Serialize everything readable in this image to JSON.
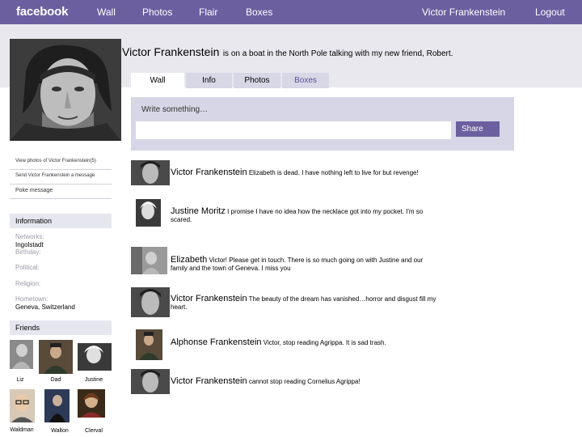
{
  "nav": {
    "logo": "facebook",
    "wall": "Wall",
    "photos": "Photos",
    "flair": "Flair",
    "boxes": "Boxes",
    "user": "Victor Frankenstein",
    "logout": "Logout"
  },
  "profile": {
    "name": "Victor Frankenstein",
    "status": "is on a boat in the North Pole talking with my new friend, Robert."
  },
  "tabs": [
    "Wall",
    "Info",
    "Photos",
    "Boxes"
  ],
  "composer": {
    "label": "Write something…",
    "value": "",
    "share": "Share"
  },
  "sidebar": {
    "links": [
      "View photos of Victor Frankenstein(5)",
      "Send Victor Frankenstein a message",
      "Poke message"
    ],
    "information_title": "Information",
    "info": {
      "networks_label": "Networks:",
      "networks_value": "Ingolstadt",
      "birthday_label": "Birthday:",
      "political_label": "Political:",
      "religion_label": "Religion:",
      "hometown_label": "Hometown:",
      "hometown_value": "Geneva, Switzerland"
    },
    "friends_title": "Friends",
    "friends": [
      "Liz",
      "Dad",
      "Justine",
      "Waldman",
      "Walton",
      "Clerval"
    ]
  },
  "posts": [
    {
      "author": "Victor Frankenstein",
      "text": "Elizabeth is dead.  I have nothing left to live for but revenge!"
    },
    {
      "author": "Justine Moritz",
      "text": "I promise I have no idea how the necklace got into my pocket.  I'm so scared."
    },
    {
      "author": "Elizabeth",
      "text": "Victor!  Please get in touch.  There is so much going on with Justine and our family and the town of Geneva.  I miss you"
    },
    {
      "author": "Victor Frankenstein",
      "text": "The beauty of the dream has vanished…horror and disgust fill my heart."
    },
    {
      "author": "Alphonse Frankenstein",
      "text": "Victor, stop reading Agrippa.  It is sad trash."
    },
    {
      "author": "Victor Frankenstein",
      "text": "cannot stop reading Cornelius Agrippa!"
    }
  ],
  "colors": {
    "brand": "#6b5fa0",
    "band": "#e8e8ee",
    "composer": "#d6d6e6"
  }
}
